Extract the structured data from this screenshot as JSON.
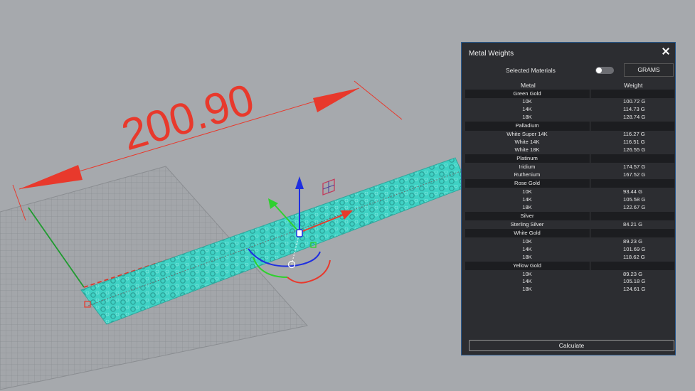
{
  "viewport": {
    "dimension_label": "200.90",
    "colors": {
      "background": "#a6a9ad",
      "dimension": "#e8392c",
      "part": "#3fd1c4",
      "x_axis": "#e8392c",
      "y_axis": "#2fd12f",
      "z_axis": "#1f2fe0"
    }
  },
  "panel": {
    "title": "Metal Weights",
    "selected_materials_label": "Selected Materials",
    "units_button": "GRAMS",
    "column_metal": "Metal",
    "column_weight": "Weight",
    "groups": [
      {
        "name": "Green Gold",
        "items": [
          {
            "metal": "10K",
            "weight": "100.72 G"
          },
          {
            "metal": "14K",
            "weight": "114.73 G"
          },
          {
            "metal": "18K",
            "weight": "128.74 G"
          }
        ]
      },
      {
        "name": "Palladium",
        "items": [
          {
            "metal": "White Super 14K",
            "weight": "116.27 G"
          },
          {
            "metal": "White 14K",
            "weight": "116.51 G"
          },
          {
            "metal": "White 18K",
            "weight": "126.55 G"
          }
        ]
      },
      {
        "name": "Platinum",
        "items": [
          {
            "metal": "Iridium",
            "weight": "174.57 G"
          },
          {
            "metal": "Ruthenium",
            "weight": "167.52 G"
          }
        ]
      },
      {
        "name": "Rose Gold",
        "items": [
          {
            "metal": "10K",
            "weight": "93.44 G"
          },
          {
            "metal": "14K",
            "weight": "105.58 G"
          },
          {
            "metal": "18K",
            "weight": "122.67 G"
          }
        ]
      },
      {
        "name": "Silver",
        "items": [
          {
            "metal": "Sterling Silver",
            "weight": "84.21 G"
          }
        ]
      },
      {
        "name": "White Gold",
        "items": [
          {
            "metal": "10K",
            "weight": "89.23 G"
          },
          {
            "metal": "14K",
            "weight": "101.69 G"
          },
          {
            "metal": "18K",
            "weight": "118.62 G"
          }
        ]
      },
      {
        "name": "Yellow Gold",
        "items": [
          {
            "metal": "10K",
            "weight": "89.23 G"
          },
          {
            "metal": "14K",
            "weight": "105.18 G"
          },
          {
            "metal": "18K",
            "weight": "124.61 G"
          }
        ]
      }
    ],
    "calculate_button": "Calculate"
  }
}
